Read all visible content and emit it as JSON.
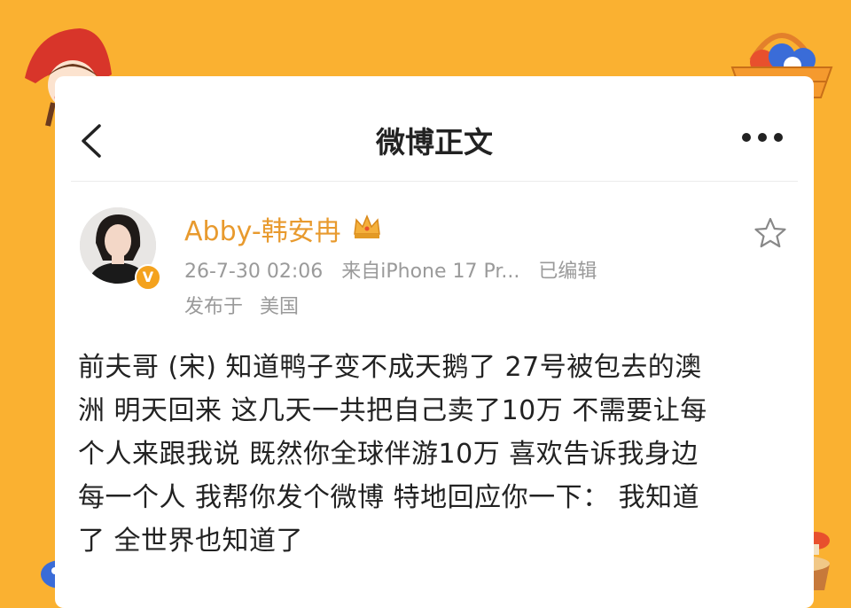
{
  "colors": {
    "background": "#FAB131",
    "username": "#E89A2E",
    "meta": "#9A9A9A",
    "text": "#222222"
  },
  "nav": {
    "back_icon": "chevron-left-icon",
    "title": "微博正文",
    "more_icon": "more-dots-icon"
  },
  "post": {
    "author": "Abby-韩安冉",
    "author_badge_icon": "crown-icon",
    "verified_icon": "verified-v-icon",
    "verified_text": "V",
    "timestamp": "26-7-30 02:06",
    "source": "来自iPhone 17 Pr...",
    "edited": "已编辑",
    "published_label": "发布于",
    "location": "美国",
    "favorite_icon": "star-icon",
    "lines": [
      "前夫哥 (宋) 知道鸭子变不成天鹅了 27号被包去的澳",
      "洲 明天回来 这几天一共把自己卖了10万 不需要让每",
      "个人来跟我说 既然你全球伴游10万 喜欢告诉我身边",
      "每一个人 我帮你发个微博 特地回应你一下：  我知道",
      "了 全世界也知道了"
    ]
  }
}
